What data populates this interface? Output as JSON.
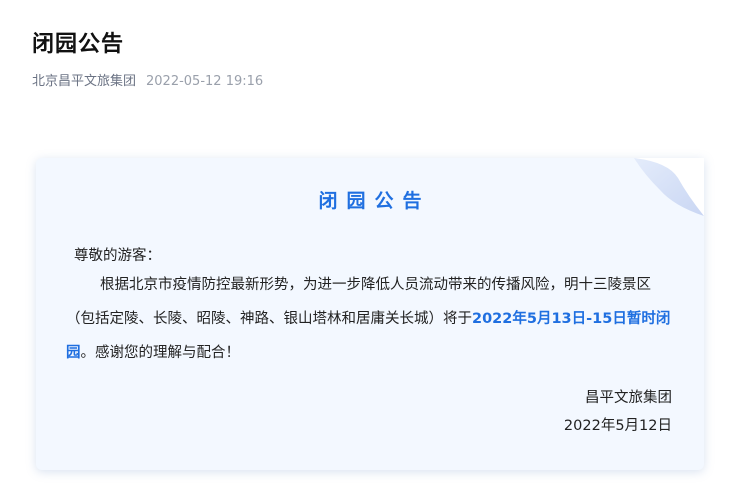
{
  "article": {
    "title": "闭园公告",
    "author": "北京昌平文旅集团",
    "date": "2022-05-12 19:16"
  },
  "notice": {
    "heading": "闭园公告",
    "greeting": "尊敬的游客：",
    "body_part1": "根据北京市疫情防控最新形势，为进一步降低人员流动带来的传播风险，明十三陵景区（包括定陵、长陵、昭陵、神路、银山塔林和居庸关长城）将于",
    "body_highlight": "2022年5月13日-15日暂时闭园",
    "body_part2": "。感谢您的理解与配合！",
    "signature_org": "昌平文旅集团",
    "signature_date": "2022年5月12日"
  },
  "colors": {
    "accent": "#1f6fe0",
    "card_background": "#f3f8ff",
    "meta_text": "#6b7384"
  }
}
